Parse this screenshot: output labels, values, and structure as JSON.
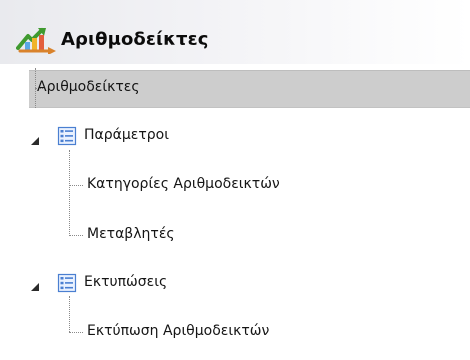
{
  "app": {
    "title": "Αριθμοδείκτες",
    "icon": "arrows-chart-icon"
  },
  "tree": {
    "selected_root_label": "Αριθμοδείκτες",
    "groups": [
      {
        "label": "Παράμετροι",
        "icon": "list-document-icon",
        "expanded": true,
        "children": [
          {
            "label": "Κατηγορίες Αριθμοδεικτών"
          },
          {
            "label": "Μεταβλητές"
          }
        ]
      },
      {
        "label": "Εκτυπώσεις",
        "icon": "list-document-icon",
        "expanded": true,
        "children": [
          {
            "label": "Εκτύπωση Αριθμοδεικτών"
          }
        ]
      }
    ]
  },
  "colors": {
    "selection": "#cdcdcd",
    "icon_blue": "#4a7fd1"
  }
}
